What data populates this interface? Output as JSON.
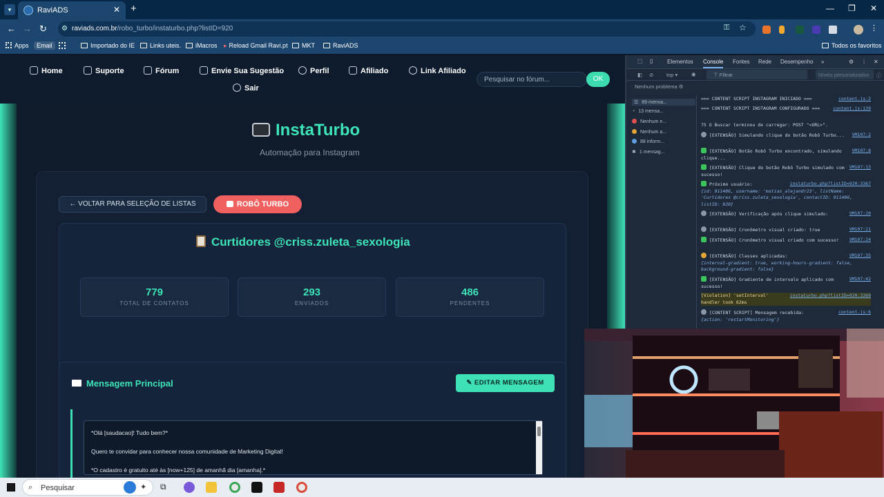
{
  "browser": {
    "tab_title": "RaviADS",
    "url_host": "raviads.com.br",
    "url_path": "/robo_turbo/instaturbo.php?listID=920",
    "bookmarks": [
      "Apps",
      "Email",
      "Importado do IE",
      "Links uteis.",
      "iMacros",
      "Reload Gmail Ravi.pt",
      "MKT",
      "RaviADS"
    ],
    "other_bookmarks": "Todos os favoritos"
  },
  "site_nav": {
    "items": [
      "Home",
      "Suporte",
      "Fórum",
      "Envie Sua Sugestão",
      "Perfil",
      "Afiliado",
      "Link Afiliado"
    ],
    "logout": "Sair",
    "search_placeholder": "Pesquisar no fórum...",
    "search_button": "OK"
  },
  "brand": {
    "title": "InstaTurbo",
    "icon": "camera-icon",
    "subtitle": "Automação para Instagram"
  },
  "actions": {
    "back": "← VOLTAR PARA SELEÇÃO DE LISTAS",
    "robo": "ROBÔ TURBO"
  },
  "list": {
    "title": "Curtidores @criss.zuleta_sexologia",
    "stats": [
      {
        "value": "779",
        "label": "TOTAL DE CONTATOS"
      },
      {
        "value": "293",
        "label": "ENVIADOS"
      },
      {
        "value": "486",
        "label": "PENDENTES"
      }
    ]
  },
  "message": {
    "title": "Mensagem Principal",
    "edit_button": "EDITAR MENSAGEM",
    "lines": [
      "*Olá [saudacao]! Tudo bem?*",
      "Quero te convidar para conhecer nossa comunidade de Marketing Digital!",
      "*O cadastro é gratuito até às [now+125] de amanhã dia [amanha].*"
    ]
  },
  "devtools": {
    "tabs": [
      "Elementos",
      "Console",
      "Fontes",
      "Rede",
      "Desempenho"
    ],
    "context": "top",
    "filter_placeholder": "Filtrar",
    "levels": "Níveis personalizados",
    "issues": "Nenhum problema",
    "sidebar": [
      "89 mensa...",
      "13 mensa...",
      "Nenhum e...",
      "Nenhum a...",
      "88 inform...",
      "1 mensag..."
    ],
    "logs": [
      {
        "text": "=== CONTENT SCRIPT INSTAGRAM INICIADO ===",
        "src": "content.js:2"
      },
      {
        "text": "=== CONTENT SCRIPT INSTAGRAM CONFIGURADO ===",
        "src": "content.js:139"
      },
      {
        "text": "75  O Buscar terminou de carregar: POST \"<URL>\".",
        "src": ""
      },
      {
        "text": "[EXTENSÃO] Simulando clique do botão Robô Turbo...",
        "src": "VM107:2"
      },
      {
        "text": "[EXTENSÃO] Botão Robô Turbo encontrado, simulando clique...",
        "src": "VM107:8"
      },
      {
        "text": "[EXTENSÃO] Clique do botão Robô Turbo simulado com sucesso!",
        "src": "VM107:13"
      },
      {
        "text": "Próximo usuário:",
        "src": "instaturbo.php?listID=920:3367",
        "detail": "{id: 911406, username: 'matias_alejandr23', listName: 'Curtidores @criss.zuleta_sexologia', contactID: 911406, listID: 920}"
      },
      {
        "text": "[EXTENSÃO] Verificação após clique simulado:",
        "src": "VM107:20"
      },
      {
        "text": "[EXTENSÃO] Cronômetro visual criado: true",
        "src": "VM107:21"
      },
      {
        "text": "[EXTENSÃO] Cronômetro visual criado com sucesso!",
        "src": "VM107:24"
      },
      {
        "text": "[EXTENSÃO] Classes aplicadas:",
        "src": "VM107:35",
        "detail": "{interval-gradient: true, working-hours-gradient: false, background-gradient: false}"
      },
      {
        "text": "[EXTENSÃO] Gradiente de intervalo aplicado com sucesso!",
        "src": "VM107:42"
      },
      {
        "text": "[Violation] 'setInterval' handler took 62ms",
        "src": "instaturbo.php?listID=920:3269"
      },
      {
        "text": "[CONTENT SCRIPT] Mensagem recebida:",
        "src": "content.js:6",
        "detail": "{action: 'restartMonitoring'}"
      }
    ]
  },
  "taskbar": {
    "search": "Pesquisar"
  }
}
